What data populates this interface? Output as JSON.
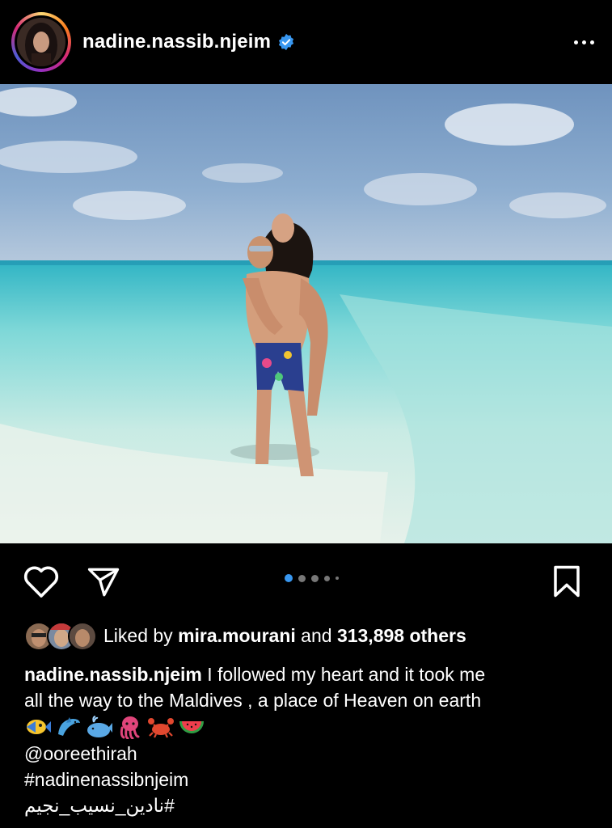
{
  "post": {
    "username": "nadine.nassib.njeim",
    "verified": true,
    "more_icon": "more-horizontal-icon",
    "carousel": {
      "total": 5,
      "active_index": 0
    }
  },
  "actions": {
    "like_icon": "heart-icon",
    "share_icon": "send-icon",
    "save_icon": "bookmark-icon"
  },
  "likes": {
    "prefix": "Liked by",
    "user": "mira.mourani",
    "connector": "and",
    "others": "313,898 others"
  },
  "caption": {
    "username": "nadine.nassib.njeim",
    "line1": "I followed my heart and it took me",
    "line2": "all the way to the Maldives , a place of Heaven on earth",
    "emojis": [
      "tropical-fish",
      "dolphin",
      "whale",
      "octopus",
      "crab",
      "watermelon"
    ],
    "mention": "@ooreethirah",
    "hashtag1": "#nadinenassibnjeim",
    "hashtag2": "#نادين_نسيب_نجيم"
  },
  "colors": {
    "background": "#000000",
    "text": "#ffffff",
    "verified": "#3897f0",
    "carousel_active": "#3897f0",
    "carousel_inactive": "#777777"
  }
}
